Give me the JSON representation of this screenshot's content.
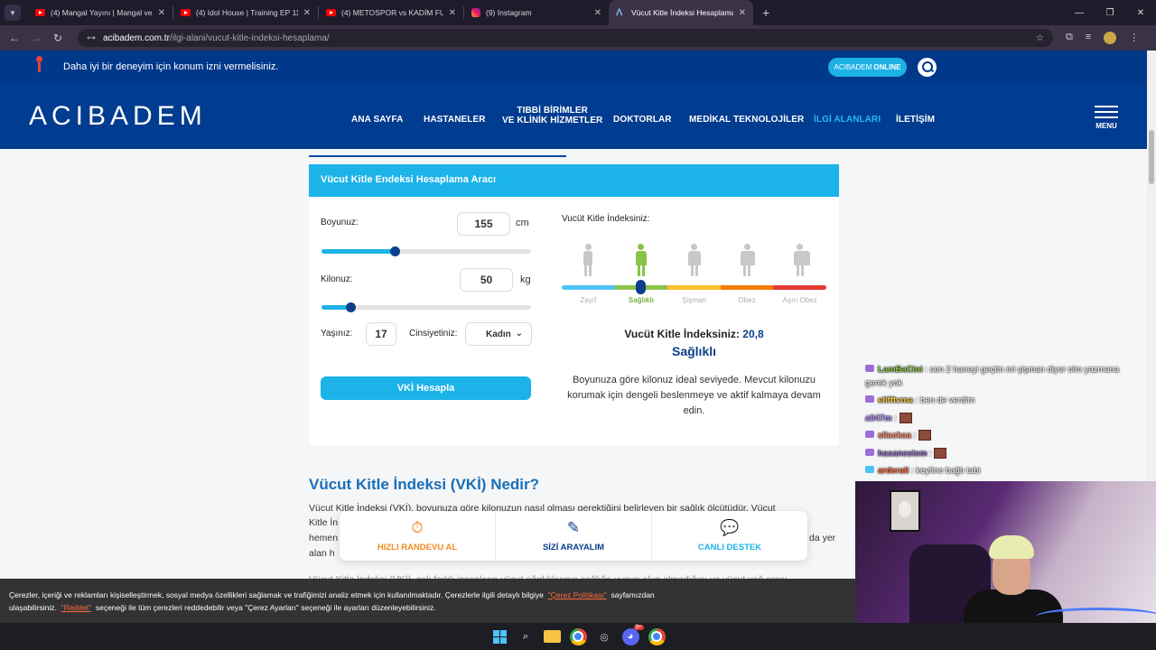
{
  "browser": {
    "tabs": [
      {
        "label": "(4) Mangal Yayını | Mangal ve Tü",
        "icon": "youtube-icon",
        "active": false
      },
      {
        "label": "(4) Idol House | Training EP 11 |",
        "icon": "youtube-icon",
        "active": false
      },
      {
        "label": "(4) METOSPOR vs KADİM FUTB",
        "icon": "youtube-icon",
        "active": false
      },
      {
        "label": "(9) Instagram",
        "icon": "instagram-icon",
        "active": false
      },
      {
        "label": "Vücut Kitle İndeksi Hesaplama",
        "icon": "acibadem-icon",
        "active": true
      }
    ],
    "url_host": "acibadem.com.tr",
    "url_path": "/ilgi-alani/vucut-kitle-indeksi-hesaplama/"
  },
  "site": {
    "location_prompt": "Daha iyi bir deneyim için konum izni vermelisiniz.",
    "online_label_prefix": "ACIBADEM",
    "online_label_suffix": "ONLINE",
    "logo": "ACIBADEM",
    "nav": {
      "home": "ANA SAYFA",
      "hospitals": "HASTANELER",
      "units_line1": "TIBBİ BİRİMLER",
      "units_line2": "VE KLİNİK HİZMETLER",
      "doctors": "DOKTORLAR",
      "medtech": "MEDİKAL TEKNOLOJİLER",
      "interests": "İLGİ ALANLARI",
      "contact": "İLETİŞİM",
      "menu": "MENU"
    }
  },
  "calculator": {
    "title": "Vücut Kitle Endeksi Hesaplama Aracı",
    "height_label": "Boyunuz:",
    "height_value": "155",
    "height_unit": "cm",
    "height_slider_fraction": 0.35,
    "weight_label": "Kilonuz:",
    "weight_value": "50",
    "weight_unit": "kg",
    "weight_slider_fraction": 0.14,
    "age_label": "Yaşınız:",
    "age_value": "17",
    "gender_label": "Cinsiyetiniz:",
    "gender_value": "Kadın",
    "button": "VKİ Hesapla",
    "index_label": "Vucüt Kitle İndeksiniz:",
    "categories": [
      "Zayıf",
      "Sağlıklı",
      "Şişman",
      "Obez",
      "Aşırı Obez"
    ],
    "category_colors": [
      "#4fc3f7",
      "#8bc34a",
      "#fbc02d",
      "#f57c00",
      "#e53935"
    ],
    "selected_category_index": 1,
    "result_label": "Vucüt Kitle İndeksiniz:",
    "result_value": "20,8",
    "result_category": "Sağlıklı",
    "advice": "Boyunuza göre kilonuz ideal seviyede. Mevcut kilonuzu korumak için dengeli beslenmeye ve aktif kalmaya devam edin."
  },
  "article": {
    "title": "Vücut Kitle İndeksi (VKİ) Nedir?",
    "p1": "Vücut Kitle İndeksi (VKİ), boyunuza göre kilonuzun nasıl olması gerektiğini belirleyen bir sağlık ölçütüdür. Vücut",
    "p2": "Kitle İn",
    "p3": "hemen",
    "p3_right": "da yer",
    "p4": "alan h",
    "p5": "Vücut Kitle İndeksi (VKİ), çok farklı insanların vücut ağırlıklarının sağlığa uygun olup olmadığını ve vücut yağ oranı"
  },
  "actions": [
    {
      "label": "HIZLI RANDEVU AL",
      "icon": "clock-icon",
      "color": "#f08a1d"
    },
    {
      "label": "SİZİ ARAYALIM",
      "icon": "form-icon",
      "color": "#0b3f8a"
    },
    {
      "label": "CANLI DESTEK",
      "icon": "chat-bubbles-icon",
      "color": "#1bb3e8"
    }
  ],
  "cookie": {
    "text1": "Çerezler, içeriği ve reklamları kişiselleştirmek, sosyal medya özellikleri sağlamak ve trafiğimizi analiz etmek için kullanılmaktadır. Çerezlerle ilgili detaylı bilgiye",
    "link1": "\"Çerez Politikası\"",
    "text2": "sayfamızdan",
    "text3": "ulaşabilirsiniz.",
    "link2": "\"Reddet\"",
    "text4": "seçeneği ile tüm çerezleri reddedebilir veya \"Çerez Ayarları\" seçeneği ile ayarları düzenleyebilirsiniz."
  },
  "chat": [
    {
      "user": "LamBaCini",
      "user_color": "#8bc34a",
      "text": ": son 2 haneyi geçtin mi şişman diyor olm yazmana",
      "cont": "gerek yok"
    },
    {
      "user": "elifftvma",
      "user_color": "#f0c040",
      "text": ": ben de verdim"
    },
    {
      "user": "ali47m",
      "user_color": "#b090ff",
      "text": ":"
    },
    {
      "user": "sllackaa",
      "user_color": "#ff8a65",
      "text": ":"
    },
    {
      "user": "hasanesiem",
      "user_color": "#9575cd",
      "text": ":"
    },
    {
      "user": "arderali",
      "user_color": "#ff7043",
      "text": ": keyfine bağlı tabi"
    }
  ],
  "taskbar": {
    "discord_badge": "9+"
  }
}
